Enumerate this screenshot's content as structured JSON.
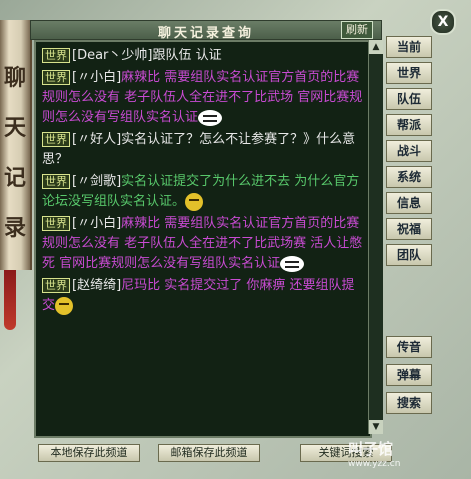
{
  "window": {
    "title": "聊天记录查询",
    "refresh_label": "刷新",
    "close_label": "X"
  },
  "side_scroll": {
    "chars": [
      "聊",
      "天",
      "记",
      "录"
    ]
  },
  "messages": [
    {
      "channel": "世界",
      "name": "[Dear丶少帅]",
      "text": "跟队伍 认证",
      "text_color": "name"
    },
    {
      "channel": "世界",
      "name": "[〃小白]",
      "text": "麻辣比 需要组队实名认证官方首页的比赛规则怎么没有 老子队伍人全在进不了比武场 官网比赛规则怎么没有写组队实名认证",
      "text_color": "m"
    },
    {
      "channel": "世界",
      "name": "[〃好人]",
      "text": "实名认证了？怎么不让参赛了？》什么意思？",
      "text_color": "name"
    },
    {
      "channel": "世界",
      "name": "[〃剑歌]",
      "text": "实名认证提交了为什么进不去 为什么官方论坛没写组队实名认证。",
      "text_color": "g"
    },
    {
      "channel": "世界",
      "name": "[〃小白]",
      "text": "麻辣比 需要组队实名认证官方首页的比赛规则怎么没有 老子队伍人全在进不了比武场赛 活人让憋死 官网比赛规则怎么没有写组队实名认证",
      "text_color": "m"
    },
    {
      "channel": "世界",
      "name": "[赵绮绮]",
      "text": "尼玛比 实名提交过了 你麻痹 还要组队提交",
      "text_color": "m"
    }
  ],
  "tabs": [
    "当前",
    "世界",
    "队伍",
    "帮派",
    "战斗",
    "系统",
    "信息",
    "祝福",
    "团队"
  ],
  "tabs_lower": [
    "传音",
    "弹幕",
    "搜索"
  ],
  "footer": {
    "save_local": "本地保存此频道",
    "save_mail": "邮箱保存此频道",
    "keyword": "关键词搜索"
  },
  "watermark": {
    "text": "叫子馆",
    "url": "www.yzz.cn"
  },
  "colors": {
    "magenta": "#c84bd2",
    "green": "#58c86b",
    "frame": "#b9c3b3"
  }
}
